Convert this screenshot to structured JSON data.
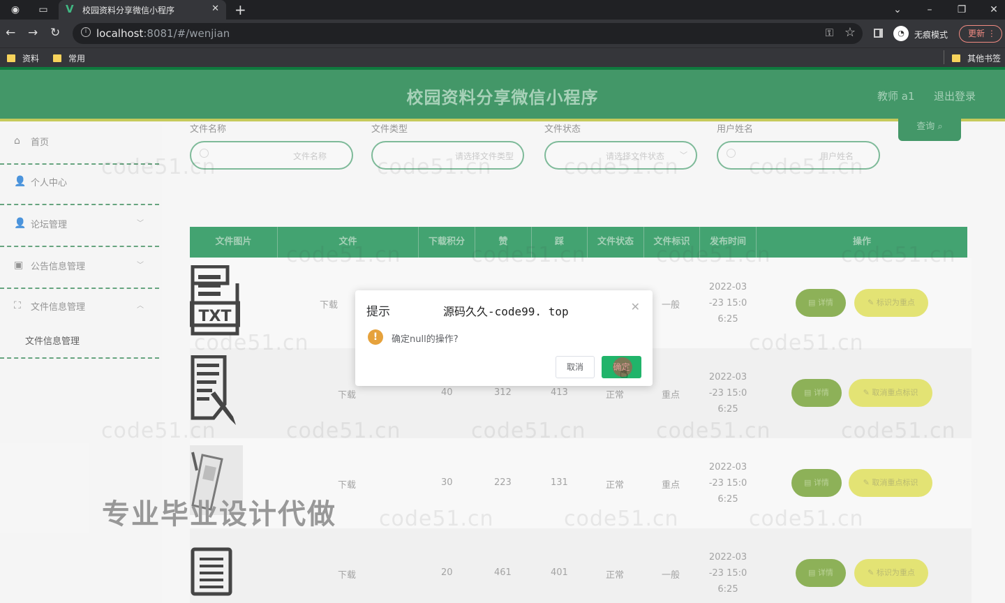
{
  "browser": {
    "tab_title": "校园资料分享微信小程序",
    "tab_close": "✕",
    "new_tab": "+",
    "url_host": "localhost",
    "url_rest": ":8081/#/wenjian",
    "incognito_label": "无痕模式",
    "update_label": "更新",
    "bookmarks": [
      "资料",
      "常用"
    ],
    "other_bookmarks": "其他书签",
    "icons": [
      "back-icon",
      "forward-icon",
      "reload-icon",
      "key-icon",
      "star-icon",
      "incognito-icon",
      "minimize-icon",
      "restore-icon",
      "close-icon"
    ]
  },
  "header": {
    "title": "校园资料分享微信小程序",
    "user": "教师 a1",
    "logout": "退出登录"
  },
  "sidebar": {
    "items": [
      {
        "label": "首页",
        "icon": "home-icon"
      },
      {
        "label": "个人中心",
        "icon": "user-icon"
      },
      {
        "label": "论坛管理",
        "icon": "user-icon"
      },
      {
        "label": "公告信息管理",
        "icon": "briefcase-icon"
      },
      {
        "label": "文件信息管理",
        "icon": "expand-icon"
      }
    ],
    "sub_item": "文件信息管理"
  },
  "search": {
    "labels": [
      "文件名称",
      "文件类型",
      "文件状态",
      "用户姓名"
    ],
    "placeholders": [
      "文件名称",
      "请选择文件类型",
      "请选择文件状态",
      "用户姓名"
    ],
    "query_button": "查询"
  },
  "table": {
    "headers": [
      "文件图片",
      "文件",
      "下载积分",
      "赞",
      "踩",
      "文件状态",
      "文件标识",
      "发布时间",
      "操作"
    ],
    "rows": [
      {
        "file": "下载",
        "points": "",
        "likes": "",
        "dislikes": "",
        "status": "",
        "tag": "一般",
        "time": [
          "2022-03",
          "-23 15:0",
          "6:25"
        ],
        "actions": [
          "详情",
          "标识为重点"
        ]
      },
      {
        "file": "下载",
        "points": "40",
        "likes": "312",
        "dislikes": "413",
        "status": "正常",
        "tag": "重点",
        "time": [
          "2022-03",
          "-23 15:0",
          "6:25"
        ],
        "actions": [
          "详情",
          "取消重点标识"
        ]
      },
      {
        "file": "下载",
        "points": "30",
        "likes": "223",
        "dislikes": "131",
        "status": "正常",
        "tag": "重点",
        "time": [
          "2022-03",
          "-23 15:0",
          "6:25"
        ],
        "actions": [
          "详情",
          "取消重点标识"
        ]
      },
      {
        "file": "下载",
        "points": "20",
        "likes": "461",
        "dislikes": "401",
        "status": "正常",
        "tag": "一般",
        "time": [
          "2022-03",
          "-23 15:0",
          "6:25"
        ],
        "actions": [
          "详情",
          "标识为重点"
        ]
      }
    ]
  },
  "overlay_text": "专业毕业设计代做",
  "watermark": "code51.cn",
  "dialog": {
    "title": "提示",
    "subtitle": "源码久久-code99. top",
    "message": "确定null的操作?",
    "cancel": "取消",
    "confirm": "确定"
  }
}
